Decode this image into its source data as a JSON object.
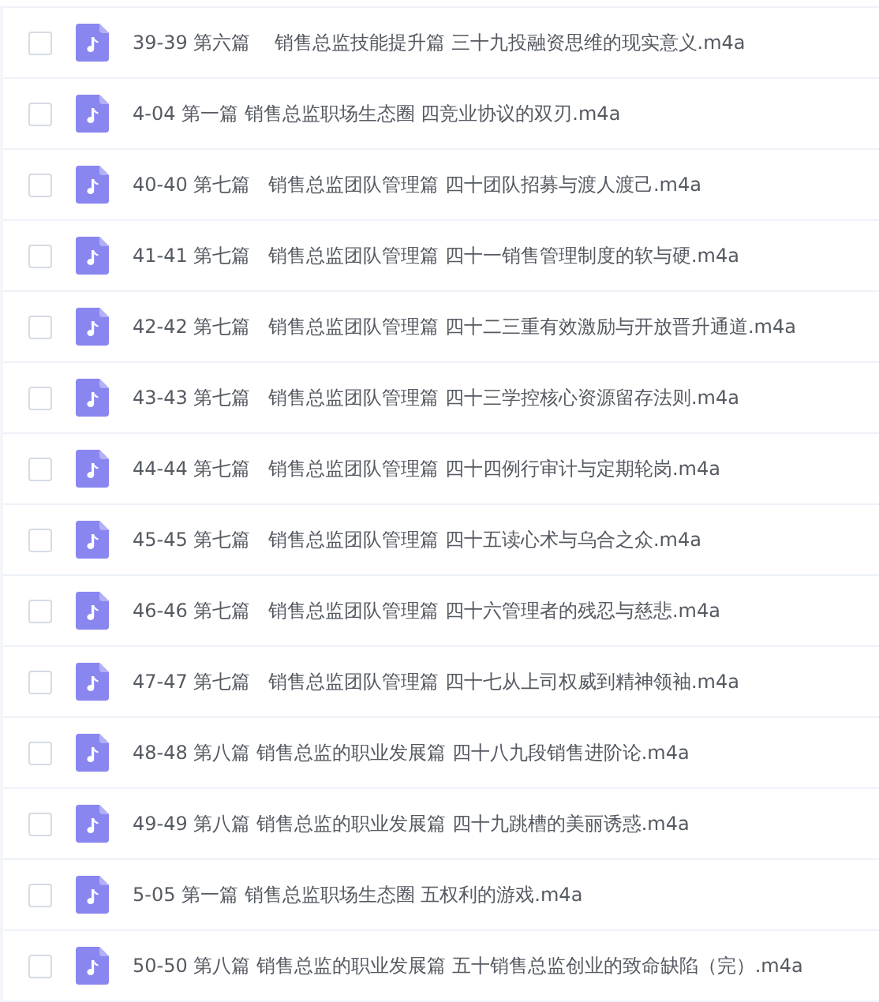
{
  "files": [
    {
      "name": "39-39 第六篇    销售总监技能提升篇 三十九投融资思维的现实意义.m4a",
      "checked": false
    },
    {
      "name": "4-04 第一篇 销售总监职场生态圈 四竞业协议的双刃.m4a",
      "checked": false
    },
    {
      "name": "40-40 第七篇   销售总监团队管理篇 四十团队招募与渡人渡己.m4a",
      "checked": false
    },
    {
      "name": "41-41 第七篇   销售总监团队管理篇 四十一销售管理制度的软与硬.m4a",
      "checked": false
    },
    {
      "name": "42-42 第七篇   销售总监团队管理篇 四十二三重有效激励与开放晋升通道.m4a",
      "checked": false
    },
    {
      "name": "43-43 第七篇   销售总监团队管理篇 四十三学控核心资源留存法则.m4a",
      "checked": false
    },
    {
      "name": "44-44 第七篇   销售总监团队管理篇 四十四例行审计与定期轮岗.m4a",
      "checked": false
    },
    {
      "name": "45-45 第七篇   销售总监团队管理篇 四十五读心术与乌合之众.m4a",
      "checked": false
    },
    {
      "name": "46-46 第七篇   销售总监团队管理篇 四十六管理者的残忍与慈悲.m4a",
      "checked": false
    },
    {
      "name": "47-47 第七篇   销售总监团队管理篇 四十七从上司权威到精神领袖.m4a",
      "checked": false
    },
    {
      "name": "48-48 第八篇 销售总监的职业发展篇 四十八九段销售进阶论.m4a",
      "checked": false
    },
    {
      "name": "49-49 第八篇 销售总监的职业发展篇 四十九跳槽的美丽诱惑.m4a",
      "checked": false
    },
    {
      "name": "5-05 第一篇 销售总监职场生态圈 五权利的游戏.m4a",
      "checked": false
    },
    {
      "name": "50-50 第八篇 销售总监的职业发展篇 五十销售总监创业的致命缺陷（完）.m4a",
      "checked": false
    }
  ]
}
